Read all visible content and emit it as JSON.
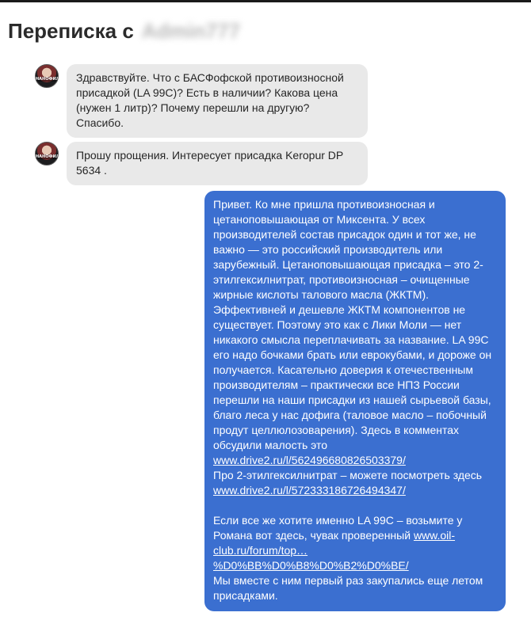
{
  "header": {
    "title": "Переписка с",
    "blurred_username": "Admin777"
  },
  "messages_incoming": [
    {
      "avatar_text": "НАНОФИЛЬ",
      "text": "Здравствуйте. Что с БАСФофской противоизносной присадкой (LA 99C)? Есть в наличии? Какова цена (нужен 1 литр)? Почему перешли на другую? Спасибо."
    },
    {
      "avatar_text": "НАНОФИЛЬ",
      "text": "Прошу прощения. Интересует присадка Keropur DP 5634 ."
    }
  ],
  "reply": {
    "paragraph1": "Привет. Ко мне пришла противоизносная и цетаноповышающая от Миксента. У всех производителей состав присадок один и тот же, не важно — это российский производитель или зарубежный. Цетаноповышающая присадка – это 2-этилгексилнитрат, противоизносная – очищенные жирные кислоты талового масла (ЖКТМ). Эффективней и дешевле ЖКТМ компонентов не существует. Поэтому это как с Лики Моли — нет никакого смысла переплачивать за название. LA 99C его надо бочками брать или еврокубами, и дороже он получается. Касательно доверия к отечественным производителям – практически все НПЗ России перешли на наши присадки из нашей сырьевой базы, благо леса у нас дофига (таловое масло – побочный продут целлюлозоварения). Здесь в комментах обсудили малость это",
    "link1": "www.drive2.ru/l/562496680826503379/",
    "line2": "Про 2-этилгексилнитрат – можете посмотреть здесь",
    "link2": "www.drive2.ru/l/572333186726494347/",
    "paragraph2": "Если все же хотите именно LA 99C – возьмите у Романа вот здесь, чувак проверенный",
    "link3": "www.oil-club.ru/forum/top…%D0%BB%D0%B8%D0%B2%D0%BE/",
    "paragraph3": "Мы вместе с ним первый раз закупались еще летом присадками."
  },
  "colors": {
    "outgoing_bubble": "#3b6fd0",
    "incoming_bubble": "#e9e9e9",
    "top_border": "#1a1a1a"
  }
}
